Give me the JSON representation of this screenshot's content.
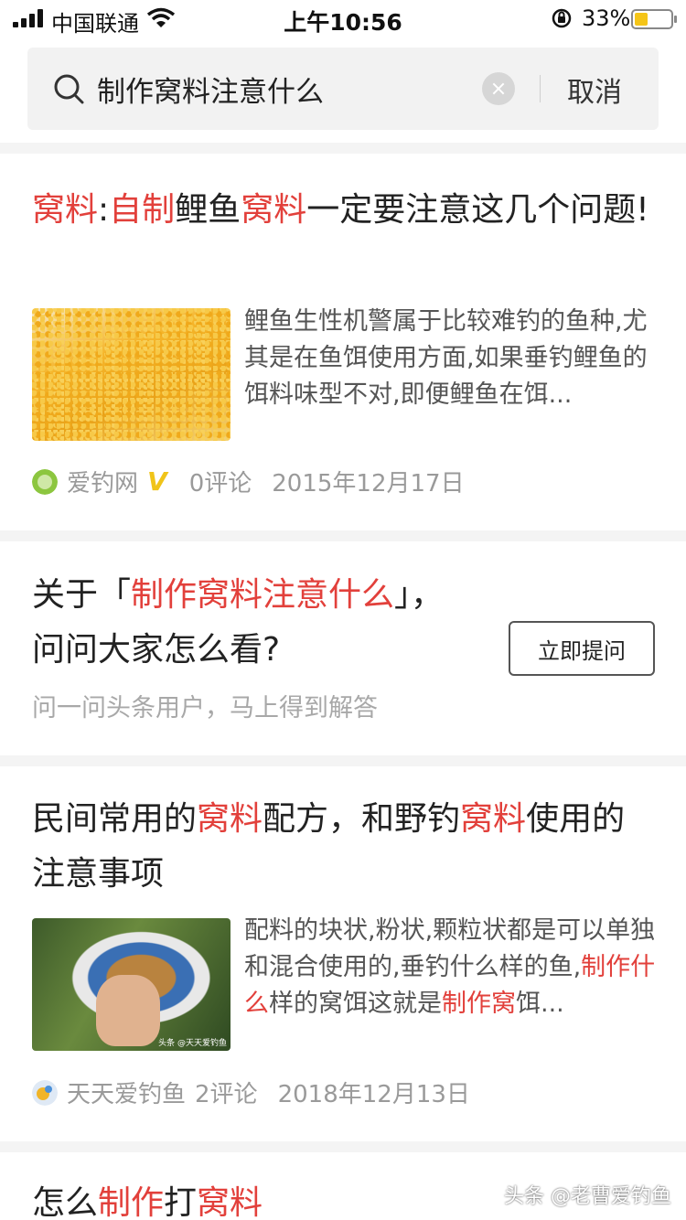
{
  "status_bar": {
    "carrier": "中国联通",
    "time": "上午10:56",
    "battery_percent": "33%",
    "battery_level": 0.33,
    "battery_color": "#f5c518"
  },
  "search": {
    "query": "制作窝料注意什么",
    "cancel_label": "取消"
  },
  "results": [
    {
      "title_parts": [
        {
          "text": "窝料",
          "hl": true
        },
        {
          "text": ":",
          "hl": false
        },
        {
          "text": "自制",
          "hl": true
        },
        {
          "text": "鲤鱼",
          "hl": false
        },
        {
          "text": "窝料",
          "hl": true
        },
        {
          "text": "一定要注意这几个问题!",
          "hl": false
        }
      ],
      "abstract_parts": [
        {
          "text": "鲤鱼生性机警属于比较难钓的鱼种,尤其是在鱼饵使用方面,如果垂钓鲤鱼的饵料味型不对,即便鲤鱼在饵...",
          "hl": false
        }
      ],
      "source": "爱钓网",
      "verified_mark": "V",
      "comments": "0评论",
      "date": "2015年12月17日"
    },
    {
      "title_parts": [
        {
          "text": "民间常用的",
          "hl": false
        },
        {
          "text": "窝料",
          "hl": true
        },
        {
          "text": "配方，和野钓",
          "hl": false
        },
        {
          "text": "窝料",
          "hl": true
        },
        {
          "text": "使用的注意事项",
          "hl": false
        }
      ],
      "abstract_parts": [
        {
          "text": "配料的块状,粉状,颗粒状都是可以单独和混合使用的,垂钓什么样的鱼,",
          "hl": false
        },
        {
          "text": "制作什么",
          "hl": true
        },
        {
          "text": "样的窝饵这就是",
          "hl": false
        },
        {
          "text": "制作窝",
          "hl": true
        },
        {
          "text": "饵...",
          "hl": false
        }
      ],
      "thumb_watermark": "头条 @天天爱钓鱼",
      "source": "天天爱钓鱼",
      "comments": "2评论",
      "date": "2018年12月13日"
    },
    {
      "title_parts": [
        {
          "text": "怎么",
          "hl": false
        },
        {
          "text": "制作",
          "hl": true
        },
        {
          "text": "打",
          "hl": false
        },
        {
          "text": "窝料",
          "hl": true
        }
      ]
    }
  ],
  "question_card": {
    "prefix": "关于「",
    "keyword": "制作窝料注意什么",
    "suffix": "」，",
    "line2": "问问大家怎么看?",
    "button_label": "立即提问",
    "subtitle": "问一问头条用户，马上得到解答"
  },
  "watermark": "头条 @老曹爱钓鱼",
  "colors": {
    "highlight": "#e2403b",
    "separator": "#f4f4f4",
    "search_bg": "#f2f2f2"
  }
}
